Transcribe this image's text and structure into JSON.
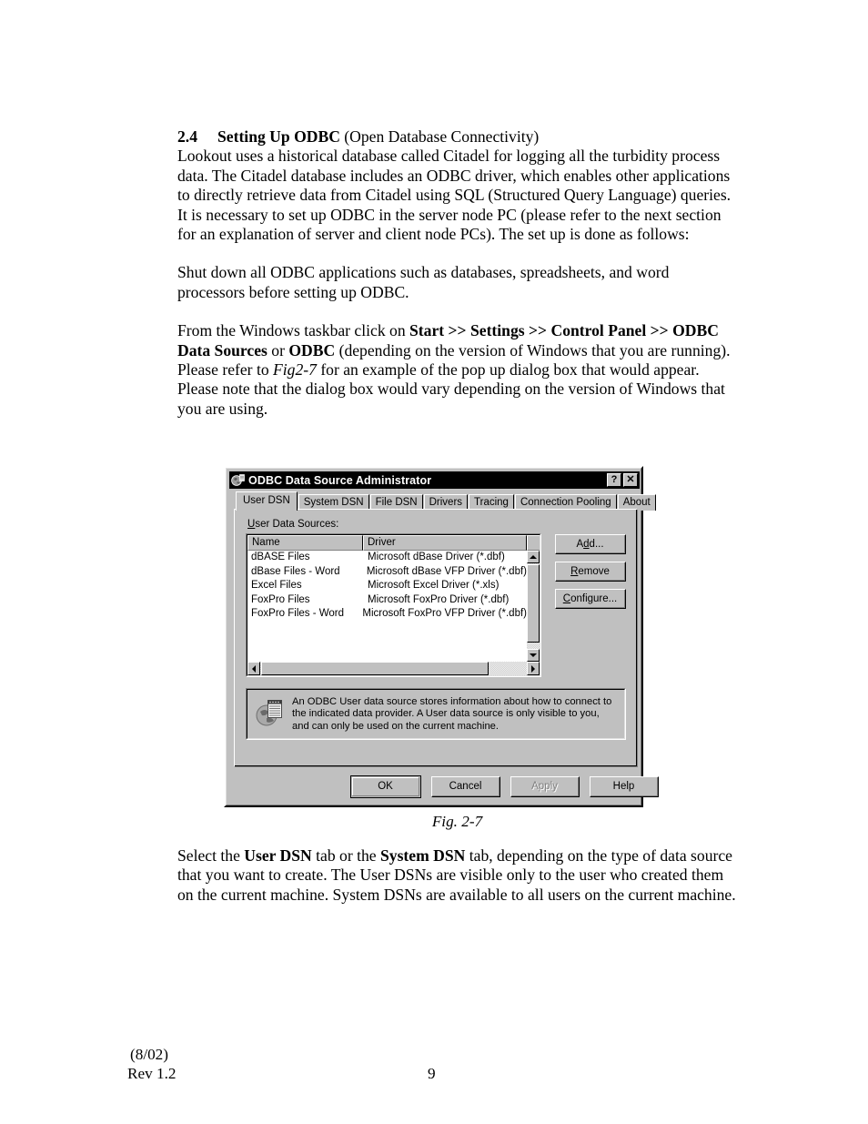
{
  "document": {
    "section": {
      "number": "2.4",
      "title": "Setting Up ODBC",
      "title_suffix": " (Open Database Connectivity)"
    },
    "paragraph1": "Lookout uses a historical database called Citadel for logging all the turbidity process data. The Citadel database includes an ODBC driver, which enables other applications to directly retrieve data from Citadel using SQL (Structured Query Language) queries. It is necessary to set up ODBC in the server node PC (please refer to the next section for an explanation of server and client node PCs). The set up is done as follows:",
    "paragraph2": "Shut down all ODBC applications such as databases, spreadsheets, and word processors before setting up ODBC.",
    "paragraph3": {
      "t1": "From the Windows taskbar click on ",
      "b1": "Start",
      "t2": " >> ",
      "b2": "Settings",
      "t3": " >> ",
      "b3": "Control Panel",
      "t4": " >> ",
      "b4": "ODBC Data Sources",
      "t5": " or ",
      "b5": "ODBC",
      "t6": " (depending on the version of Windows that you are running). Please refer to ",
      "i1": "Fig2-7",
      "t7": " for an example of the pop up dialog box that would appear. Please note that the dialog box would vary depending on the version of Windows that you are using."
    },
    "figure_caption": "Fig. 2-7",
    "paragraph4": {
      "t1": "Select the ",
      "b1": "User DSN",
      "t2": " tab or the ",
      "b2": "System DSN",
      "t3": " tab, depending on the type of data source that you want to create. The User DSNs are visible only to the user who created them on the current machine. System DSNs are available to all users on the current machine."
    },
    "footer": {
      "date": "(8/02)",
      "revision": "Rev 1.2",
      "page_number": "9"
    }
  },
  "dialog": {
    "title": "ODBC Data Source Administrator",
    "title_icon": "odbc-globe-icon",
    "help_button": "?",
    "close_button": "✕",
    "tabs": [
      {
        "label": "User DSN",
        "active": true
      },
      {
        "label": "System DSN",
        "active": false
      },
      {
        "label": "File DSN",
        "active": false
      },
      {
        "label": "Drivers",
        "active": false
      },
      {
        "label": "Tracing",
        "active": false
      },
      {
        "label": "Connection Pooling",
        "active": false
      },
      {
        "label": "About",
        "active": false
      }
    ],
    "list_label_underlined": "U",
    "list_label_rest": "ser Data Sources:",
    "columns": [
      "Name",
      "Driver"
    ],
    "rows": [
      {
        "name": "dBASE Files",
        "driver": "Microsoft dBase Driver (*.dbf)"
      },
      {
        "name": "dBase Files - Word",
        "driver": "Microsoft dBase VFP Driver (*.dbf)"
      },
      {
        "name": "Excel Files",
        "driver": "Microsoft Excel Driver (*.xls)"
      },
      {
        "name": "FoxPro Files",
        "driver": "Microsoft FoxPro Driver (*.dbf)"
      },
      {
        "name": "FoxPro Files - Word",
        "driver": "Microsoft FoxPro VFP Driver (*.dbf)"
      }
    ],
    "side_buttons": [
      {
        "pre": "A",
        "accel": "d",
        "post": "d...",
        "name": "add"
      },
      {
        "pre": "",
        "accel": "R",
        "post": "emove",
        "name": "remove"
      },
      {
        "pre": "",
        "accel": "C",
        "post": "onfigure...",
        "name": "configure"
      }
    ],
    "info_icon": "odbc-datasource-icon",
    "info_text": "An ODBC User data source stores information about how to connect to the indicated data provider.   A User data source is only visible to you, and can only be used on the current machine.",
    "bottom_buttons": [
      {
        "label": "OK",
        "state": "default"
      },
      {
        "label": "Cancel",
        "state": "enabled"
      },
      {
        "label": "Apply",
        "state": "disabled"
      },
      {
        "label": "Help",
        "state": "enabled"
      }
    ]
  },
  "colors": {
    "dialog_face": "#c0c0c0",
    "titlebar": "#000000",
    "titlebar_text": "#ffffff",
    "listview_bg": "#ffffff",
    "disabled_text": "#808080"
  }
}
